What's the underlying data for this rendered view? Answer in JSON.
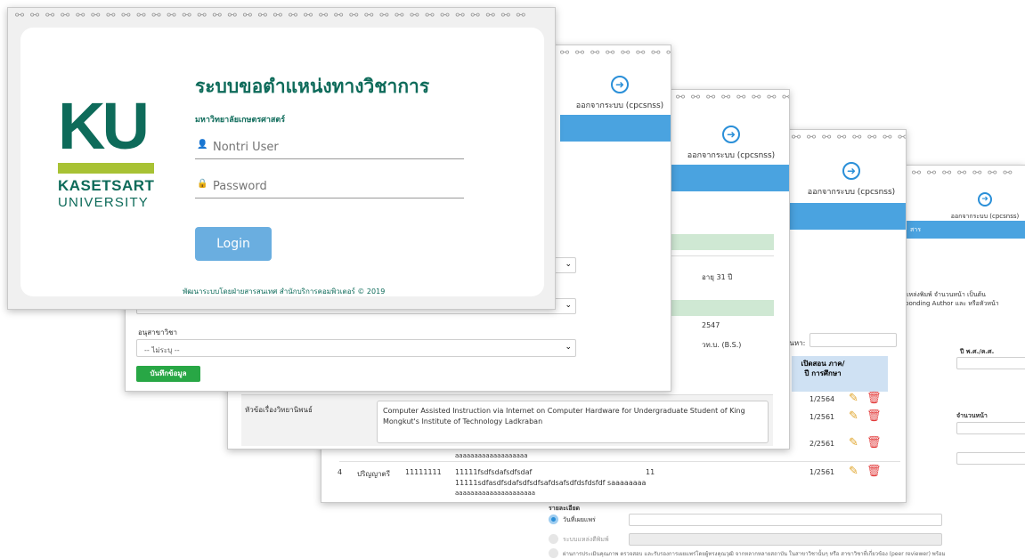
{
  "logout": {
    "label": "ออกจากระบบ (cpcsnss)"
  },
  "login": {
    "title": "ระบบขอตำแหน่งทางวิชาการ",
    "subtitle": "มหาวิทยาลัยเกษตรศาสตร์",
    "logo_text": "KU",
    "logo_name": "KASETSART",
    "logo_sub": "UNIVERSITY",
    "username_placeholder": "Nontri User",
    "password_placeholder": "Password",
    "login_button": "Login",
    "footer": "พัฒนาระบบโดยฝ่ายสารสนเทศ สำนักบริการคอมพิวเตอร์ © 2019"
  },
  "form2": {
    "sub_major_label": "อนุสาขาวิชา",
    "sub_major_value": "-- ไม่ระบุ --",
    "save_button": "บันทึกข้อมูล"
  },
  "form3": {
    "age": "อายุ 31 ปี",
    "year": "2547",
    "degree": "วท.บ. (B.S.)",
    "thesis_label": "หัวข้อเรื่องวิทยานิพนธ์",
    "thesis_value": "Computer Assisted Instruction via Internet on Computer Hardware for Undergraduate Student of King Mongkut's Institute of Technology Ladkraban"
  },
  "table4": {
    "search_label": "ค้นหา:",
    "col_semester": "เปิดสอน ภาค/ปี การศึกษา",
    "semesters": [
      "1/2564",
      "1/2561",
      "2/2561",
      "1/2561"
    ],
    "row_tail": "aaaaaaaaaaaaaaaaaaa",
    "row4": {
      "num": "4",
      "level": "ปริญญาตรี",
      "code": "11111111",
      "line1": "11111fsdfsdafsdfsdaf",
      "line2": "11111sdfasdfsdafsdfsdfsafdsafsdfdsfdsfdf saaaaaaaa",
      "line3": "aaaaaaaaaaaaaaaaaaaaa",
      "credits": "11"
    },
    "detail_label": "รายละเอียด",
    "radio1": "วันที่เผยแพร่",
    "radio2": "ระบบแหล่งตีพิมพ์",
    "radio3": "ผ่านการประเมินคุณภาพ ตรวจสอบ และรับรองการเผยแพร่โดยผู้ทรงคุณวุฒิ จากหลากหลายสถาบัน ในสาขาวิชานั้นๆ หรือ สาขาวิชาที่เกี่ยวข้อง (peer reviewer) พร้อม"
  },
  "form5": {
    "note1": "แหล่งพิมพ์ จำนวนหน้า เป็นต้น",
    "note2": "ponding Author และ หรือหัวหน้า",
    "year_label": "ปี พ.ศ./ค.ศ.",
    "pages_label": "จำนวนหน้า",
    "bar_text": "สาร"
  },
  "colors": {
    "accent": "#4aa3e0",
    "green": "#28a745",
    "ku_green": "#0e6b5a",
    "ku_lime": "#a8c234"
  }
}
